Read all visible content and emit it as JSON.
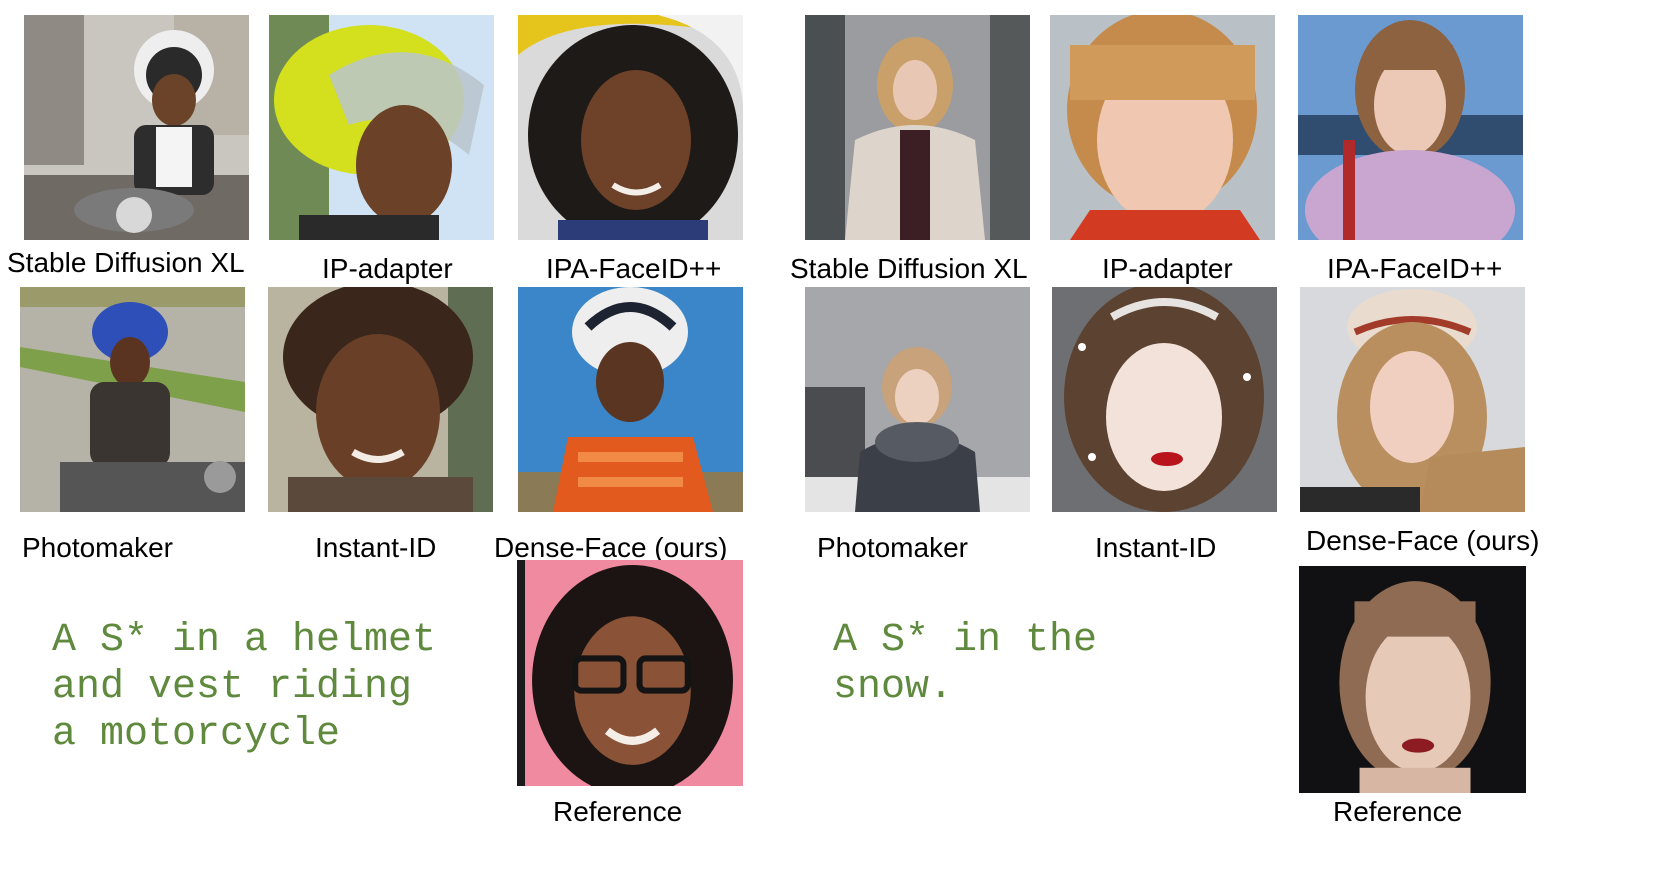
{
  "left_panel": {
    "row1_captions": [
      "Stable Diffusion XL",
      "IP-adapter",
      "IPA-FaceID++"
    ],
    "row2_captions": [
      "Photomaker",
      "Instant-ID",
      "Dense-Face (ours)"
    ],
    "prompt_lines": [
      "A S* in a helmet",
      "and vest riding",
      "a motorcycle"
    ],
    "reference_caption": "Reference"
  },
  "right_panel": {
    "row1_captions": [
      "Stable Diffusion XL",
      "IP-adapter",
      "IPA-FaceID++"
    ],
    "row2_captions": [
      "Photomaker",
      "Instant-ID",
      "Dense-Face (ours)"
    ],
    "prompt_lines": [
      "A S* in the",
      "snow."
    ],
    "reference_caption": "Reference"
  },
  "colors": {
    "prompt_text": "#5f8a3e",
    "caption_text": "#000000"
  }
}
